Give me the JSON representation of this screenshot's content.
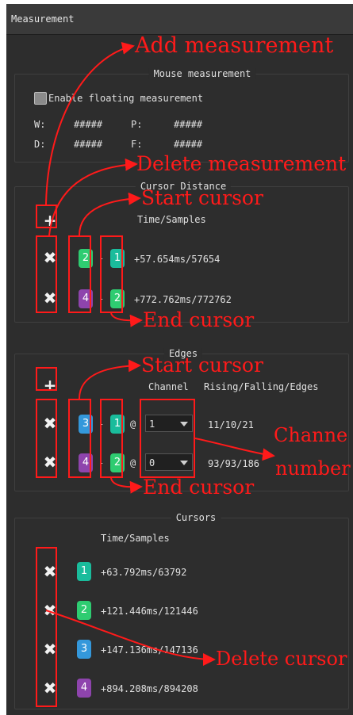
{
  "window_title": "Measurement",
  "mouse": {
    "title": "Mouse measurement",
    "enable_label": "Enable floating measurement",
    "w_label": "W:",
    "w_value": "#####",
    "p_label": "P:",
    "p_value": "#####",
    "d_label": "D:",
    "d_value": "#####",
    "f_label": "F:",
    "f_value": "#####"
  },
  "cursor_distance": {
    "title": "Cursor Distance",
    "header": "Time/Samples",
    "add_icon": "plus-icon",
    "delete_icon": "close-icon",
    "rows": [
      {
        "start": "2",
        "start_color": "#2ecc71",
        "sep": "-",
        "end": "1",
        "end_color": "#1abc9c",
        "value": "+57.654ms/57654"
      },
      {
        "start": "4",
        "start_color": "#8e44ad",
        "sep": "-",
        "end": "2",
        "end_color": "#2ecc71",
        "value": "+772.762ms/772762"
      }
    ]
  },
  "edges": {
    "title": "Edges",
    "channel_header": "Channel",
    "count_header": "Rising/Falling/Edges",
    "rows": [
      {
        "start": "3",
        "start_color": "#3498db",
        "sep": "-",
        "end": "1",
        "end_color": "#1abc9c",
        "at": "@",
        "channel": "1",
        "counts": "11/10/21"
      },
      {
        "start": "4",
        "start_color": "#8e44ad",
        "sep": "-",
        "end": "2",
        "end_color": "#2ecc71",
        "at": "@",
        "channel": "0",
        "counts": "93/93/186"
      }
    ]
  },
  "cursors": {
    "title": "Cursors",
    "header": "Time/Samples",
    "rows": [
      {
        "id": "1",
        "color": "#1abc9c",
        "value": "+63.792ms/63792"
      },
      {
        "id": "2",
        "color": "#2ecc71",
        "value": "+121.446ms/121446"
      },
      {
        "id": "3",
        "color": "#3498db",
        "value": "+147.136ms/147136"
      },
      {
        "id": "4",
        "color": "#8e44ad",
        "value": "+894.208ms/894208"
      }
    ]
  },
  "annotations": {
    "add_measurement": "Add measurement",
    "delete_measurement": "Delete measurement",
    "start_cursor": "Start cursor",
    "end_cursor": "End cursor",
    "start_cursor_2": "Start cursor",
    "end_cursor_2": "End cursor",
    "channel_line1": "Channe",
    "channel_line2": "number",
    "delete_cursor": "Delete cursor",
    "color": "#ff1a1a"
  }
}
